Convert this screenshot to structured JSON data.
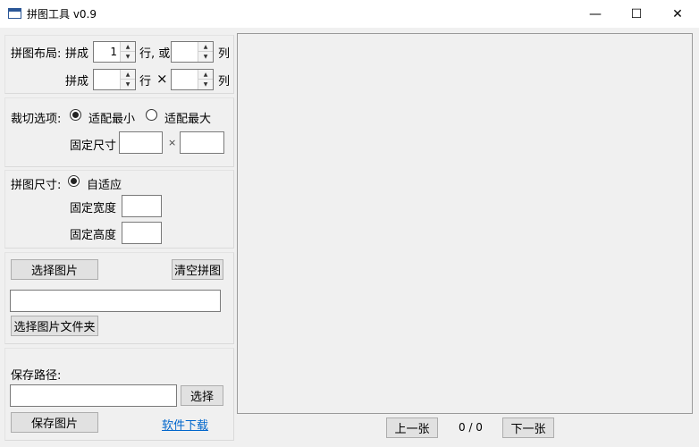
{
  "window": {
    "title": "拼图工具 v0.9",
    "minimize": "—",
    "maximize": "☐",
    "close": "✕"
  },
  "layout_section": {
    "label": "拼图布局:",
    "row1_prefix": "拼成",
    "row1_rows_value": "1",
    "row1_mid": "行, 或",
    "row1_cols_value": "",
    "row1_suffix": "列",
    "row2_prefix": "拼成",
    "row2_rows_value": "",
    "row2_mid": "行",
    "row2_x": "×",
    "row2_cols_value": "",
    "row2_suffix": "列"
  },
  "crop_section": {
    "label": "裁切选项:",
    "option_min": "适配最小",
    "option_max": "适配最大",
    "fixed_size_label": "固定尺寸",
    "times": "×",
    "width_value": "",
    "height_value": ""
  },
  "size_section": {
    "label": "拼图尺寸:",
    "option_auto": "自适应",
    "fixed_width_label": "固定宽度",
    "fixed_height_label": "固定高度",
    "width_value": "",
    "height_value": ""
  },
  "images_section": {
    "select_images": "选择图片",
    "clear": "清空拼图",
    "folder_path": "",
    "select_folder": "选择图片文件夹"
  },
  "save_section": {
    "label": "保存路径:",
    "path_value": "",
    "choose": "选择",
    "save": "保存图片",
    "download_link": "软件下载"
  },
  "nav": {
    "prev": "上一张",
    "counter": "0 / 0",
    "next": "下一张"
  },
  "icons": {
    "up_arrow": "▲",
    "down_arrow": "▼"
  }
}
